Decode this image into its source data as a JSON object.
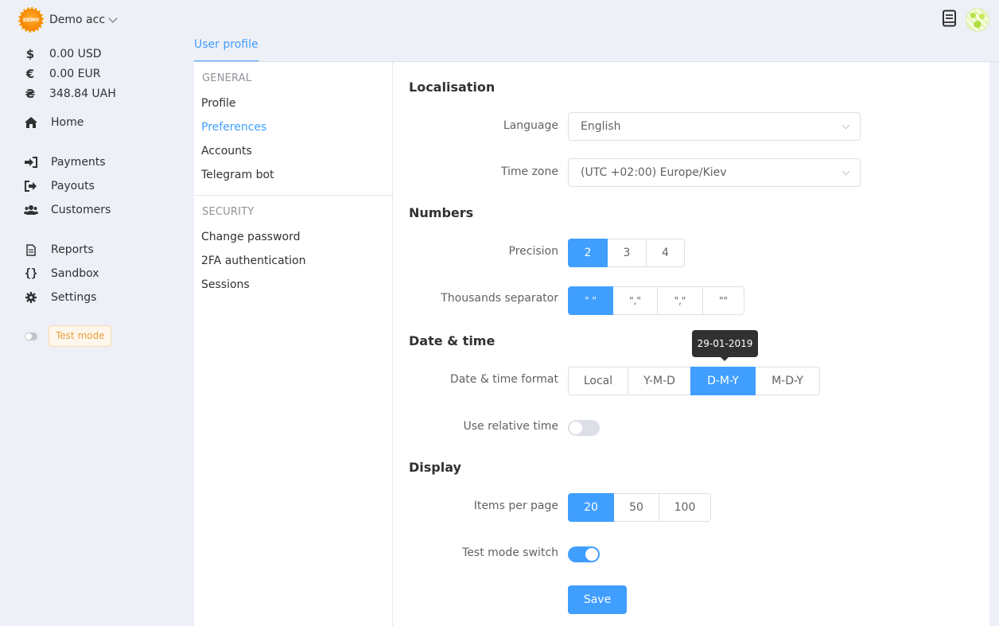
{
  "account": {
    "name": "Demo acc",
    "logo_text": "DEMO"
  },
  "balances": [
    {
      "symbol": "$",
      "value": "0.00 USD"
    },
    {
      "symbol": "€",
      "value": "0.00 EUR"
    },
    {
      "symbol": "₴",
      "value": "348.84 UAH"
    }
  ],
  "nav": {
    "home": "Home",
    "payments": "Payments",
    "payouts": "Payouts",
    "customers": "Customers",
    "reports": "Reports",
    "sandbox": "Sandbox",
    "settings": "Settings"
  },
  "test_mode": {
    "label": "Test mode"
  },
  "tab": {
    "label": "User profile"
  },
  "menu": {
    "general_head": "GENERAL",
    "general_items": [
      "Profile",
      "Preferences",
      "Accounts",
      "Telegram bot"
    ],
    "security_head": "SECURITY",
    "security_items": [
      "Change password",
      "2FA authentication",
      "Sessions"
    ]
  },
  "sections": {
    "localisation": "Localisation",
    "numbers": "Numbers",
    "datetime": "Date & time",
    "display": "Display"
  },
  "fields": {
    "language": {
      "label": "Language",
      "value": "English"
    },
    "timezone": {
      "label": "Time zone",
      "value": "(UTC +02:00) Europe/Kiev"
    },
    "precision": {
      "label": "Precision",
      "options": [
        "2",
        "3",
        "4"
      ],
      "selected": "2"
    },
    "thousands": {
      "label": "Thousands separator",
      "options": [
        "\" \"",
        "\",\"",
        "\",\"",
        "\"\""
      ],
      "selected": "\" \""
    },
    "datetime_format": {
      "label": "Date & time format",
      "options": [
        "Local",
        "Y-M-D",
        "D-M-Y",
        "M-D-Y"
      ],
      "selected": "D-M-Y",
      "tooltip": "29-01-2019"
    },
    "relative_time": {
      "label": "Use relative time",
      "on": false
    },
    "items_per_page": {
      "label": "Items per page",
      "options": [
        "20",
        "50",
        "100"
      ],
      "selected": "20"
    },
    "test_mode_switch": {
      "label": "Test mode switch",
      "on": true
    }
  },
  "save_label": "Save",
  "colors": {
    "accent": "#409eff",
    "warning": "#e6a23c",
    "background": "#eef0f7"
  }
}
